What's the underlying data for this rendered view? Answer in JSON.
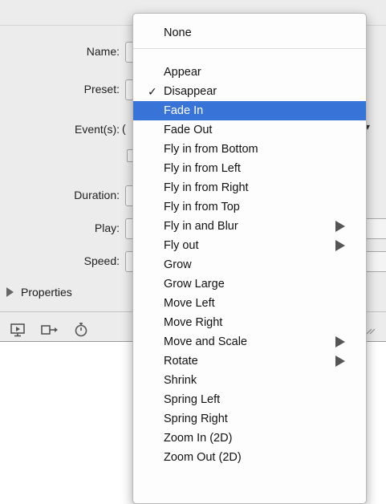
{
  "form": {
    "name_label": "Name:",
    "preset_label": "Preset:",
    "events_label": "Event(s):",
    "events_value_stub": "(",
    "duration_label": "Duration:",
    "play_label": "Play:",
    "speed_label": "Speed:",
    "properties_label": "Properties"
  },
  "toolbar_icons": [
    "preview-icon",
    "export-icon",
    "timer-icon",
    "resize-grip-icon"
  ],
  "menu": {
    "selected_index": 3,
    "checked_index": 2,
    "items": [
      {
        "label": "None",
        "submenu": false
      },
      {
        "label": "Appear",
        "submenu": false
      },
      {
        "label": "Disappear",
        "submenu": false,
        "checked": true
      },
      {
        "label": "Fade In",
        "submenu": false,
        "highlighted": true
      },
      {
        "label": "Fade Out",
        "submenu": false
      },
      {
        "label": "Fly in from Bottom",
        "submenu": false
      },
      {
        "label": "Fly in from Left",
        "submenu": false
      },
      {
        "label": "Fly in from Right",
        "submenu": false
      },
      {
        "label": "Fly in from Top",
        "submenu": false
      },
      {
        "label": "Fly in and Blur",
        "submenu": true
      },
      {
        "label": "Fly out",
        "submenu": true
      },
      {
        "label": "Grow",
        "submenu": false
      },
      {
        "label": "Grow Large",
        "submenu": false
      },
      {
        "label": "Move Left",
        "submenu": false
      },
      {
        "label": "Move Right",
        "submenu": false
      },
      {
        "label": "Move and Scale",
        "submenu": true
      },
      {
        "label": "Rotate",
        "submenu": true
      },
      {
        "label": "Shrink",
        "submenu": false
      },
      {
        "label": "Spring Left",
        "submenu": false
      },
      {
        "label": "Spring Right",
        "submenu": false
      },
      {
        "label": "Zoom In (2D)",
        "submenu": false
      },
      {
        "label": "Zoom Out (2D)",
        "submenu": false
      }
    ],
    "check_glyph": "✓"
  },
  "colors": {
    "highlight": "#3874d8",
    "panel_bg": "#ececec",
    "menu_bg": "#fdfdfd"
  }
}
